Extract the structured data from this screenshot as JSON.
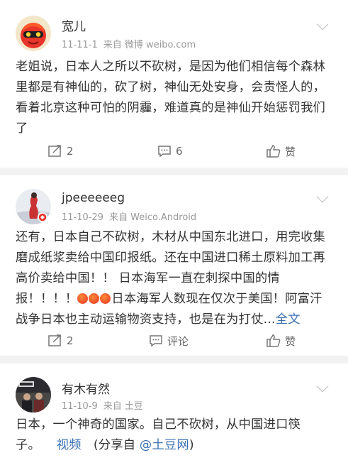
{
  "posts": [
    {
      "username": "宽儿",
      "date": "11-11-1",
      "source_prefix": "来自",
      "source": "微博 weibo.com",
      "text": "老姐说，日本人之所以不砍树，是因为他们相信每个森林里都是有神仙的，砍了树，神仙无处安身，会责怪人的，看着北京这种可怕的阴霾，难道真的是神仙开始惩罚我们了",
      "reposts": "2",
      "comments": "6",
      "like_label": "赞"
    },
    {
      "username": "jpeeeeeeg",
      "date": "11-10-29",
      "source_prefix": "来自",
      "source": "Weico.Android",
      "text_part1": "还有，日本自己不砍树，木材从中国东北进口，用完收集磨成纸浆卖给中国印报纸。还在中国进口稀土原料加工再高价卖给中国！！ 日本海军一直在刺探中国的情报！！！！",
      "text_part2": "日本海军人数现在仅次于美国！阿富汗战争日本也主动运输物资支持，也是在为打仗...",
      "expand_label": "全文",
      "reposts": "2",
      "comments_label": "评论",
      "like_label": "赞"
    },
    {
      "username": "有木有然",
      "date": "11-10-9",
      "source_prefix": "来自",
      "source": "土豆",
      "text_part1": "日本，一个神奇的国家。自己不砍树，从中国进口筷子。",
      "video_label": "视频",
      "share_prefix": "(分享自",
      "share_mention": "@土豆网",
      "share_suffix": ")"
    }
  ],
  "colors": {
    "link": "#3a6fb5",
    "text": "#333333",
    "meta": "#999999",
    "action": "#666666",
    "background": "#f2f2f2"
  },
  "icons": {
    "repost": "repost-icon",
    "comment": "comment-icon",
    "like": "like-icon",
    "more": "chevron-down-icon"
  }
}
